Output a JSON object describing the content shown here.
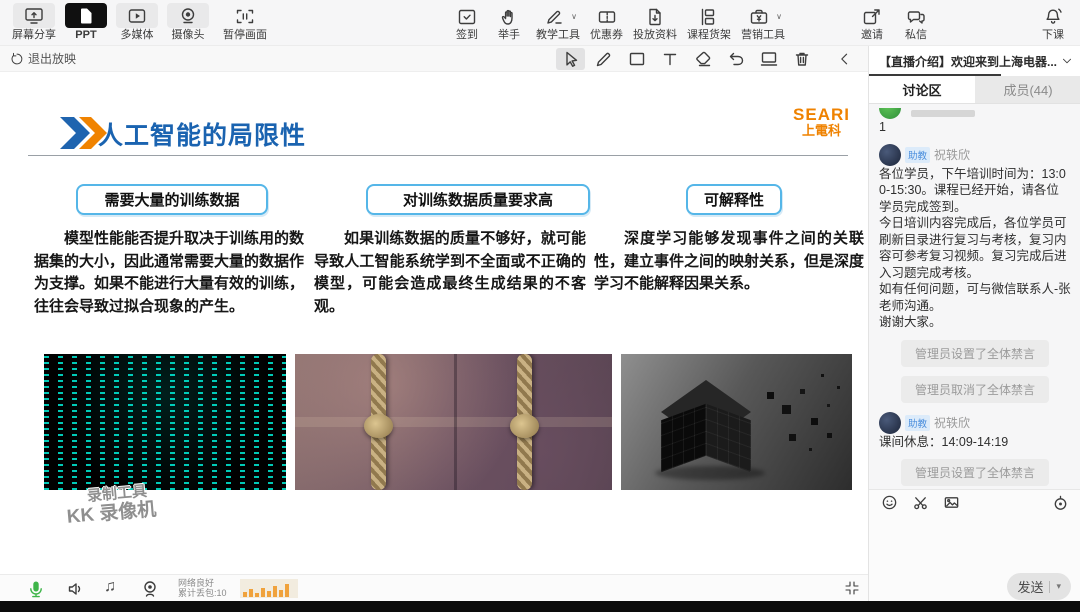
{
  "top_toolbar": {
    "mode_buttons": [
      {
        "label": "屏幕分享",
        "icon": "screen-share-icon"
      },
      {
        "label": "PPT",
        "icon": "ppt-icon",
        "active": true
      },
      {
        "label": "多媒体",
        "icon": "multimedia-icon"
      },
      {
        "label": "摄像头",
        "icon": "camera-icon"
      },
      {
        "label": "暂停画面",
        "icon": "pause-screen-icon"
      }
    ],
    "tool_buttons": [
      {
        "label": "签到",
        "icon": "sign-in-icon"
      },
      {
        "label": "举手",
        "icon": "raise-hand-icon"
      },
      {
        "label": "教学工具",
        "icon": "teaching-tools-icon",
        "has_dropdown": true
      },
      {
        "label": "优惠券",
        "icon": "coupon-icon"
      },
      {
        "label": "投放资料",
        "icon": "materials-icon"
      },
      {
        "label": "课程货架",
        "icon": "course-shelf-icon"
      },
      {
        "label": "营销工具",
        "icon": "marketing-tools-icon",
        "has_dropdown": true
      }
    ],
    "right_buttons": [
      {
        "label": "邀请",
        "icon": "invite-icon"
      },
      {
        "label": "私信",
        "icon": "private-message-icon"
      },
      {
        "label": "下课",
        "icon": "end-class-icon"
      }
    ]
  },
  "presenter_bar": {
    "exit_button": "退出放映",
    "draw_tools": [
      "select-cursor",
      "pen",
      "rectangle",
      "text",
      "eraser",
      "undo",
      "whiteboard",
      "delete",
      "prev-page",
      "next-page"
    ],
    "active_tool": "select-cursor"
  },
  "slide": {
    "title": "人工智能的局限性",
    "logo_line1": "SEARI",
    "logo_line2": "上電科",
    "columns": [
      {
        "heading": "需要大量的训练数据",
        "body": "模型性能能否提升取决于训练用的数据集的大小，因此通常需要大量的数据作为支撑。如果不能进行大量有效的训练，往往会导致过拟合现象的产生。",
        "image": "matrix-code-image"
      },
      {
        "heading": "对训练数据质量要求高",
        "body": "如果训练数据的质量不够好，就可能导致人工智能系统学到不全面或不正确的模型，可能会造成最终生成结果的不客观。",
        "image": "fraying-rope-image"
      },
      {
        "heading": "可解释性",
        "body": "深度学习能够发现事件之间的关联性，建立事件之间的映射关系，但是深度学习不能解释因果关系。",
        "image": "crumbling-cube-image"
      }
    ],
    "watermark": {
      "line1": "录制工具",
      "line2": "KK 录像机"
    }
  },
  "sidebar": {
    "announcement": "【直播介绍】欢迎来到上海电器...",
    "tabs": [
      {
        "label": "讨论区",
        "active": true
      },
      {
        "label": "成员(44)",
        "active": false
      }
    ],
    "messages": [
      {
        "type": "user",
        "text": "1"
      },
      {
        "type": "user",
        "badge": "助教",
        "name": "祝轶欣",
        "lines": [
          "各位学员，下午培训时间为：13:00-15:30。课程已经开始，请各位学员完成签到。",
          "今日培训内容完成后，各位学员可刷新目录进行复习与考核，复习内容可参考复习视频。复习完成后进入习题完成考核。",
          "如有任何问题，可与微信联系人-张老师沟通。",
          "谢谢大家。"
        ]
      },
      {
        "type": "system",
        "text": "管理员设置了全体禁言"
      },
      {
        "type": "system",
        "text": "管理员取消了全体禁言"
      },
      {
        "type": "user",
        "badge": "助教",
        "name": "祝轶欣",
        "lines": [
          "课间休息：14:09-14:19"
        ]
      },
      {
        "type": "system",
        "text": "管理员设置了全体禁言"
      }
    ],
    "composer": {
      "icons": [
        "emoji-icon",
        "screenshot-icon",
        "image-icon",
        "settings-icon"
      ],
      "send_label": "发送"
    }
  },
  "status_bar": {
    "icons": [
      "microphone-icon",
      "speaker-icon",
      "music-icon",
      "webcam-icon"
    ],
    "network_status": "网络良好",
    "packet_loss": "累计丢包:10",
    "network_bars": [
      5,
      8,
      4,
      9,
      6,
      11,
      7,
      13
    ]
  },
  "accent_colors": {
    "title_blue": "#1a63b0",
    "logo_orange": "#ef8200",
    "box_border_blue": "#55b6e8",
    "mic_green": "#3eb549",
    "chart_orange": "#f0a23c"
  }
}
